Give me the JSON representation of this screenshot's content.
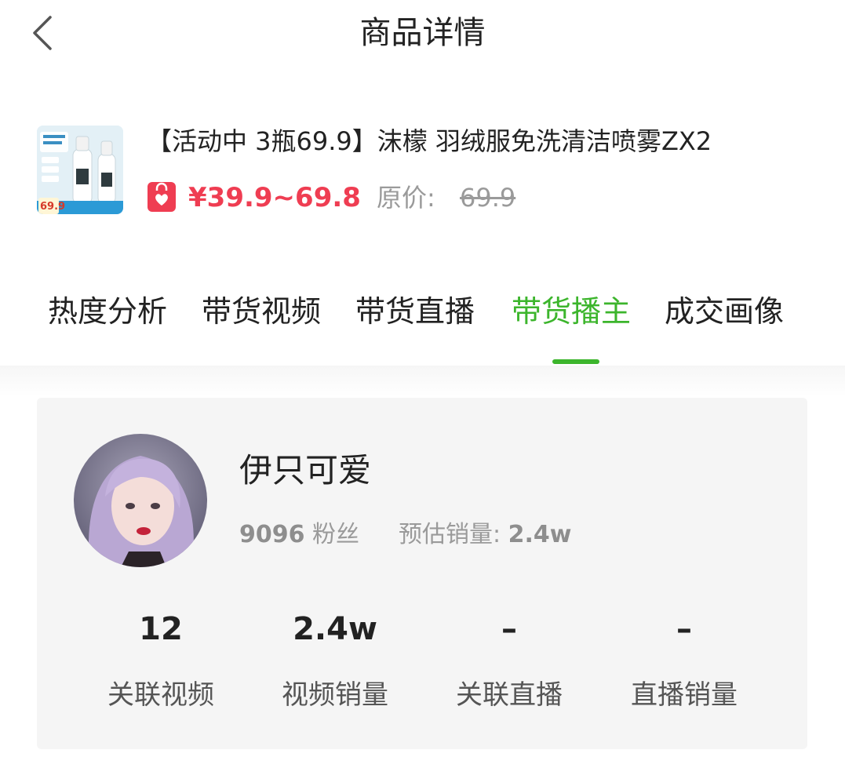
{
  "header": {
    "title": "商品详情",
    "back_icon": "chevron-left-icon"
  },
  "product": {
    "title": "【活动中 3瓶69.9】沫檬 羽绒服免洗清洁喷雾ZX2",
    "price": "¥39.9~69.8",
    "original_price_label": "原价:",
    "original_price": "69.9",
    "shop_icon": "shopping-bag-heart-icon",
    "thumb_badge_price": "69.9",
    "accent_color": "#ef3d52"
  },
  "tabs": {
    "items": [
      {
        "label": "热度分析"
      },
      {
        "label": "带货视频"
      },
      {
        "label": "带货直播"
      },
      {
        "label": "带货播主"
      },
      {
        "label": "成交画像"
      }
    ],
    "active_index": 3,
    "active_color": "#3cb52c"
  },
  "streamer": {
    "name": "伊只可爱",
    "fans_count": "9096",
    "fans_label": "粉丝",
    "est_sales_label": "预估销量:",
    "est_sales_value": "2.4w",
    "stats": [
      {
        "value": "12",
        "label": "关联视频"
      },
      {
        "value": "2.4w",
        "label": "视频销量"
      },
      {
        "value": "–",
        "label": "关联直播"
      },
      {
        "value": "–",
        "label": "直播销量"
      }
    ]
  }
}
